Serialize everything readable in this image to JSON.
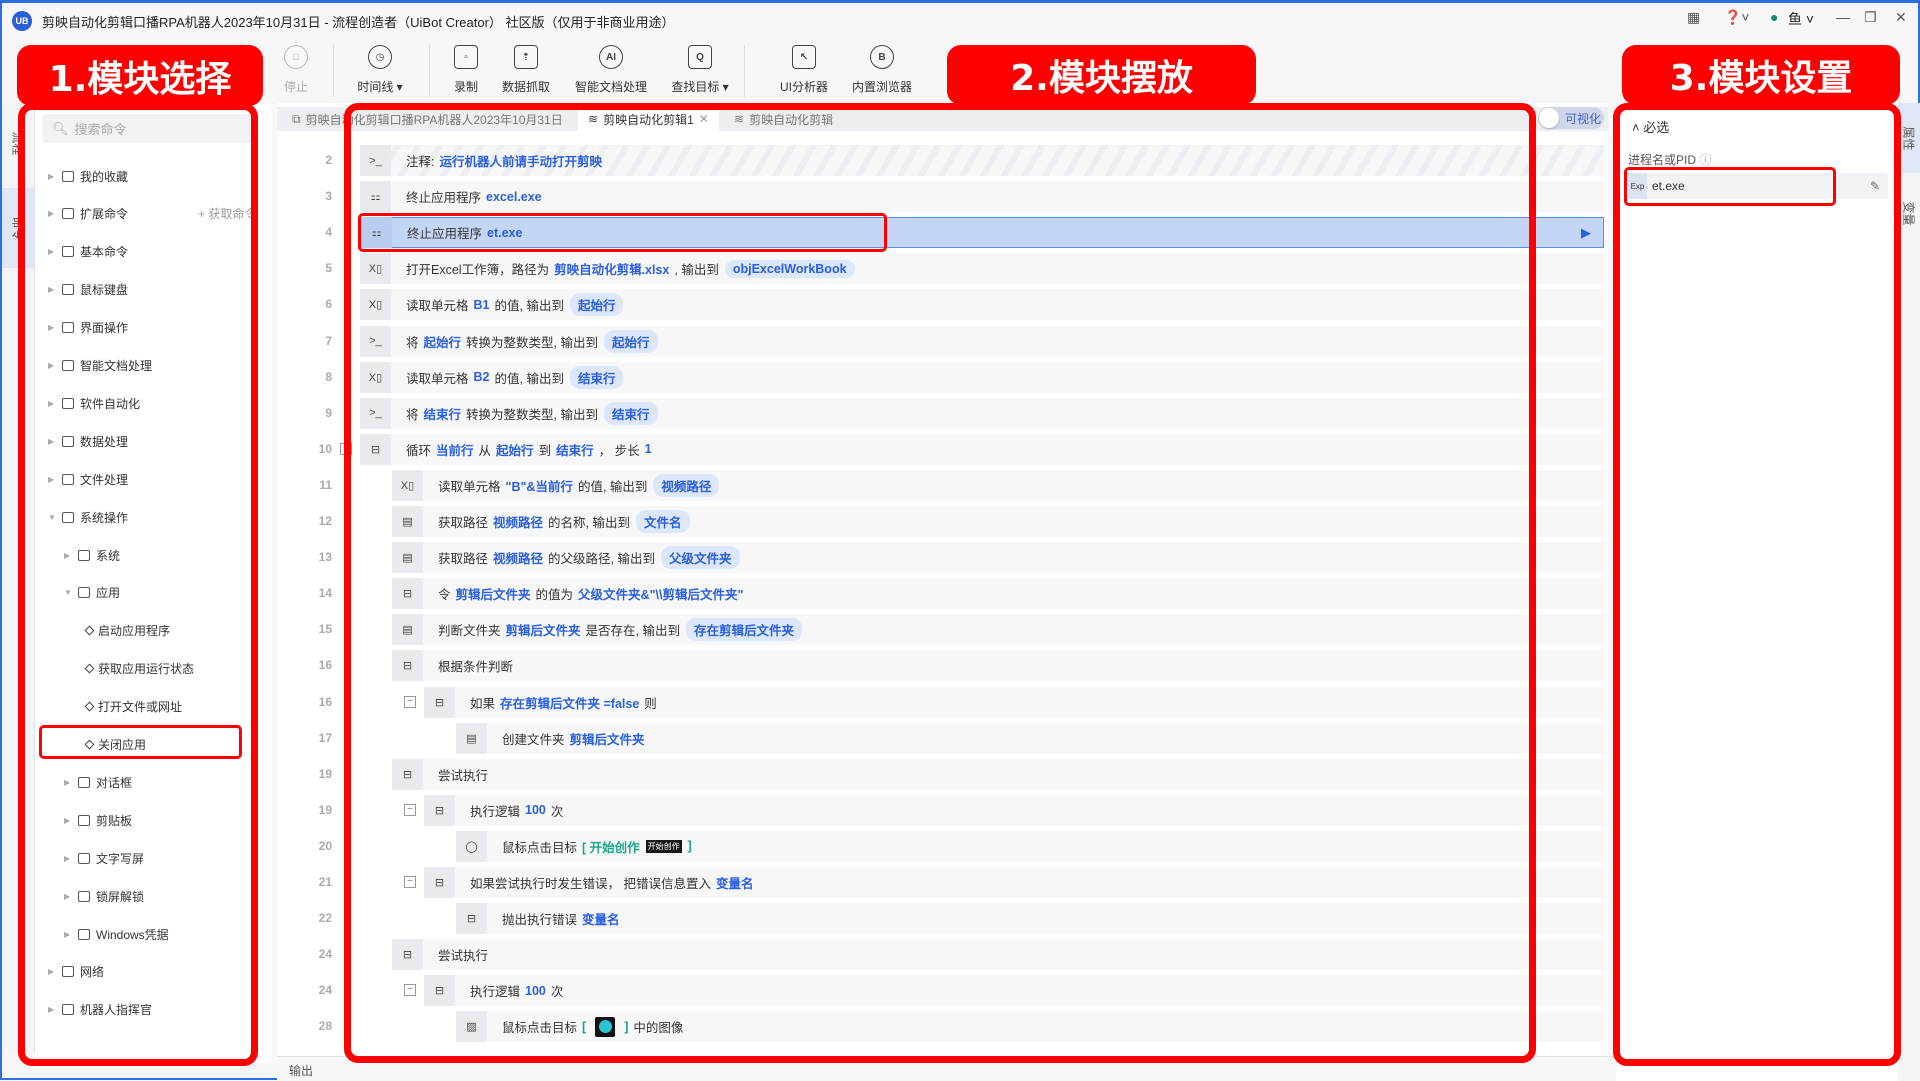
{
  "window": {
    "title": "剪映自动化剪辑口播RPA机器人2023年10月31日 - 流程创造者（UiBot Creator） 社区版（仅用于非商业用途）",
    "logo": "UB",
    "user": "鱼"
  },
  "toolbar": [
    {
      "label": "停止",
      "icon": "stop-icon",
      "glyph": "□",
      "disabled": true
    },
    {
      "label": "时间线 ▾",
      "icon": "clock-icon",
      "glyph": "◷"
    },
    {
      "label": "录制",
      "icon": "record-icon",
      "glyph": "▫"
    },
    {
      "label": "数据抓取",
      "icon": "data-scrape-icon",
      "glyph": "⇡"
    },
    {
      "label": "智能文档处理",
      "icon": "ai-doc-icon",
      "glyph": "AI"
    },
    {
      "label": "查找目标 ▾",
      "icon": "find-target-icon",
      "glyph": "Q"
    },
    {
      "label": "UI分析器",
      "icon": "ui-analyzer-icon",
      "glyph": "↖"
    },
    {
      "label": "内置浏览器",
      "icon": "browser-icon",
      "glyph": "B"
    }
  ],
  "left_strip": [
    "流程",
    "命令"
  ],
  "right_strip": [
    "属性",
    "变量"
  ],
  "sidebar": {
    "search_placeholder": "搜索命令",
    "get_command": "+ 获取命令",
    "items": [
      {
        "label": "我的收藏",
        "level": 0
      },
      {
        "label": "扩展命令",
        "level": 0
      },
      {
        "label": "基本命令",
        "level": 0
      },
      {
        "label": "鼠标键盘",
        "level": 0
      },
      {
        "label": "界面操作",
        "level": 0
      },
      {
        "label": "智能文档处理",
        "level": 0
      },
      {
        "label": "软件自动化",
        "level": 0
      },
      {
        "label": "数据处理",
        "level": 0
      },
      {
        "label": "文件处理",
        "level": 0
      },
      {
        "label": "系统操作",
        "level": 0,
        "expanded": true
      },
      {
        "label": "系统",
        "level": 1
      },
      {
        "label": "应用",
        "level": 1,
        "expanded": true
      },
      {
        "label": "启动应用程序",
        "level": 2
      },
      {
        "label": "获取应用运行状态",
        "level": 2
      },
      {
        "label": "打开文件或网址",
        "level": 2
      },
      {
        "label": "关闭应用",
        "level": 2
      },
      {
        "label": "对话框",
        "level": 1
      },
      {
        "label": "剪贴板",
        "level": 1
      },
      {
        "label": "文字写屏",
        "level": 1
      },
      {
        "label": "锁屏解锁",
        "level": 1
      },
      {
        "label": "Windows凭据",
        "level": 1
      },
      {
        "label": "网络",
        "level": 0
      },
      {
        "label": "机器人指挥官",
        "level": 0
      }
    ]
  },
  "tabs": [
    {
      "label": "剪映自动化剪辑口播RPA机器人2023年10月31日",
      "active": false
    },
    {
      "label": "剪映自动化剪辑1",
      "active": true,
      "closable": true
    },
    {
      "label": "剪映自动化剪辑",
      "active": false
    }
  ],
  "visual_toggle": "可视化",
  "code_rows": [
    {
      "ln": "2",
      "lvl": 0,
      "icon": "terminal",
      "stripe": true,
      "segs": [
        [
          "n",
          "注释: "
        ],
        [
          "v",
          "运行机器人前请手动打开剪映"
        ]
      ]
    },
    {
      "ln": "3",
      "lvl": 0,
      "icon": "apps",
      "segs": [
        [
          "n",
          "终止应用程序"
        ],
        [
          "v",
          "excel.exe"
        ]
      ]
    },
    {
      "ln": "4",
      "lvl": 0,
      "icon": "apps",
      "selected": true,
      "segs": [
        [
          "n",
          "终止应用程序"
        ],
        [
          "v",
          "et.exe"
        ]
      ]
    },
    {
      "ln": "5",
      "lvl": 0,
      "icon": "excel",
      "segs": [
        [
          "n",
          "打开Excel工作簿，路径为"
        ],
        [
          "v",
          "剪映自动化剪辑.xlsx"
        ],
        [
          "n",
          ", 输出到"
        ],
        [
          "p",
          "objExcelWorkBook"
        ]
      ]
    },
    {
      "ln": "6",
      "lvl": 0,
      "icon": "excel",
      "segs": [
        [
          "n",
          "读取单元格"
        ],
        [
          "v",
          "B1"
        ],
        [
          "n",
          "的值, 输出到"
        ],
        [
          "p",
          "起始行"
        ]
      ]
    },
    {
      "ln": "7",
      "lvl": 0,
      "icon": "terminal",
      "segs": [
        [
          "n",
          "将"
        ],
        [
          "v",
          "起始行"
        ],
        [
          "n",
          "转换为整数类型, 输出到"
        ],
        [
          "p",
          "起始行"
        ]
      ]
    },
    {
      "ln": "8",
      "lvl": 0,
      "icon": "excel",
      "segs": [
        [
          "n",
          "读取单元格"
        ],
        [
          "v",
          "B2"
        ],
        [
          "n",
          "的值, 输出到"
        ],
        [
          "p",
          "结束行"
        ]
      ]
    },
    {
      "ln": "9",
      "lvl": 0,
      "icon": "terminal",
      "segs": [
        [
          "n",
          "将"
        ],
        [
          "v",
          "结束行"
        ],
        [
          "n",
          "转换为整数类型, 输出到"
        ],
        [
          "p",
          "结束行"
        ]
      ]
    },
    {
      "ln": "10",
      "lvl": 0,
      "icon": "flow",
      "collapse": true,
      "segs": [
        [
          "n",
          "循环"
        ],
        [
          "v",
          "当前行"
        ],
        [
          "n",
          "从"
        ],
        [
          "v",
          "起始行"
        ],
        [
          "n",
          "到"
        ],
        [
          "v",
          "结束行"
        ],
        [
          "n",
          "， 步长"
        ],
        [
          "v",
          "1"
        ]
      ]
    },
    {
      "ln": "11",
      "lvl": 1,
      "icon": "excel",
      "segs": [
        [
          "n",
          "读取单元格"
        ],
        [
          "v",
          "\"B\"&当前行"
        ],
        [
          "n",
          "的值, 输出到"
        ],
        [
          "p",
          "视频路径"
        ]
      ]
    },
    {
      "ln": "12",
      "lvl": 1,
      "icon": "file",
      "segs": [
        [
          "n",
          "获取路径"
        ],
        [
          "v",
          "视频路径"
        ],
        [
          "n",
          "的名称, 输出到"
        ],
        [
          "p",
          "文件名"
        ]
      ]
    },
    {
      "ln": "13",
      "lvl": 1,
      "icon": "file",
      "segs": [
        [
          "n",
          "获取路径"
        ],
        [
          "v",
          "视频路径"
        ],
        [
          "n",
          "的父级路径, 输出到"
        ],
        [
          "p",
          "父级文件夹"
        ]
      ]
    },
    {
      "ln": "14",
      "lvl": 1,
      "icon": "flow",
      "segs": [
        [
          "n",
          "令"
        ],
        [
          "v",
          "剪辑后文件夹"
        ],
        [
          "n",
          "的值为"
        ],
        [
          "v",
          "父级文件夹&\"\\\\剪辑后文件夹\""
        ]
      ]
    },
    {
      "ln": "15",
      "lvl": 1,
      "icon": "file",
      "segs": [
        [
          "n",
          "判断文件夹"
        ],
        [
          "v",
          "剪辑后文件夹"
        ],
        [
          "n",
          "是否存在, 输出到"
        ],
        [
          "p",
          "存在剪辑后文件夹"
        ]
      ]
    },
    {
      "ln": "16",
      "lvl": 1,
      "icon": "flow",
      "segs": [
        [
          "n",
          "根据条件判断"
        ]
      ]
    },
    {
      "ln": "16",
      "lvl": 2,
      "icon": "flow",
      "collapse": true,
      "segs": [
        [
          "n",
          "如果"
        ],
        [
          "v",
          "存在剪辑后文件夹 =false"
        ],
        [
          "n",
          "则"
        ]
      ]
    },
    {
      "ln": "17",
      "lvl": 3,
      "icon": "file",
      "segs": [
        [
          "n",
          "创建文件夹"
        ],
        [
          "v",
          "剪辑后文件夹"
        ]
      ]
    },
    {
      "ln": "19",
      "lvl": 1,
      "icon": "flow",
      "segs": [
        [
          "n",
          "尝试执行"
        ]
      ]
    },
    {
      "ln": "19",
      "lvl": 2,
      "icon": "flow",
      "collapse": true,
      "segs": [
        [
          "n",
          "执行逻辑"
        ],
        [
          "v",
          "100"
        ],
        [
          "n",
          "次"
        ]
      ]
    },
    {
      "ln": "20",
      "lvl": 3,
      "icon": "mouse",
      "segs": [
        [
          "n",
          "鼠标点击目标"
        ],
        [
          "g",
          "[ 开始创作"
        ],
        [
          "img",
          "开始创作"
        ],
        [
          "g",
          "]"
        ]
      ]
    },
    {
      "ln": "21",
      "lvl": 2,
      "icon": "flow",
      "collapse": true,
      "segs": [
        [
          "n",
          "如果尝试执行时发生错误， 把错误信息置入"
        ],
        [
          "v",
          "变量名"
        ]
      ]
    },
    {
      "ln": "22",
      "lvl": 3,
      "icon": "flow",
      "segs": [
        [
          "n",
          "抛出执行错误"
        ],
        [
          "v",
          "变量名"
        ]
      ]
    },
    {
      "ln": "24",
      "lvl": 1,
      "icon": "flow",
      "segs": [
        [
          "n",
          "尝试执行"
        ]
      ]
    },
    {
      "ln": "24",
      "lvl": 2,
      "icon": "flow",
      "collapse": true,
      "segs": [
        [
          "n",
          "执行逻辑"
        ],
        [
          "v",
          "100"
        ],
        [
          "n",
          "次"
        ]
      ]
    },
    {
      "ln": "28",
      "lvl": 3,
      "icon": "image",
      "segs": [
        [
          "n",
          "鼠标点击目标"
        ],
        [
          "g",
          "["
        ],
        [
          "thumb",
          ""
        ],
        [
          "g",
          "]"
        ],
        [
          "n",
          "中的图像"
        ]
      ]
    }
  ],
  "output_label": "输出",
  "properties": {
    "section": "必选",
    "field_label": "进程名或PID",
    "field_prefix": "Exp",
    "field_value": "et.exe"
  },
  "annotations": {
    "one": "1.模块选择",
    "two": "2.模块摆放",
    "three": "3.模块设置"
  },
  "colors": {
    "accent": "#2a5fe0",
    "annotation": "#ff0000",
    "selected_row": "#c4d6f5"
  }
}
